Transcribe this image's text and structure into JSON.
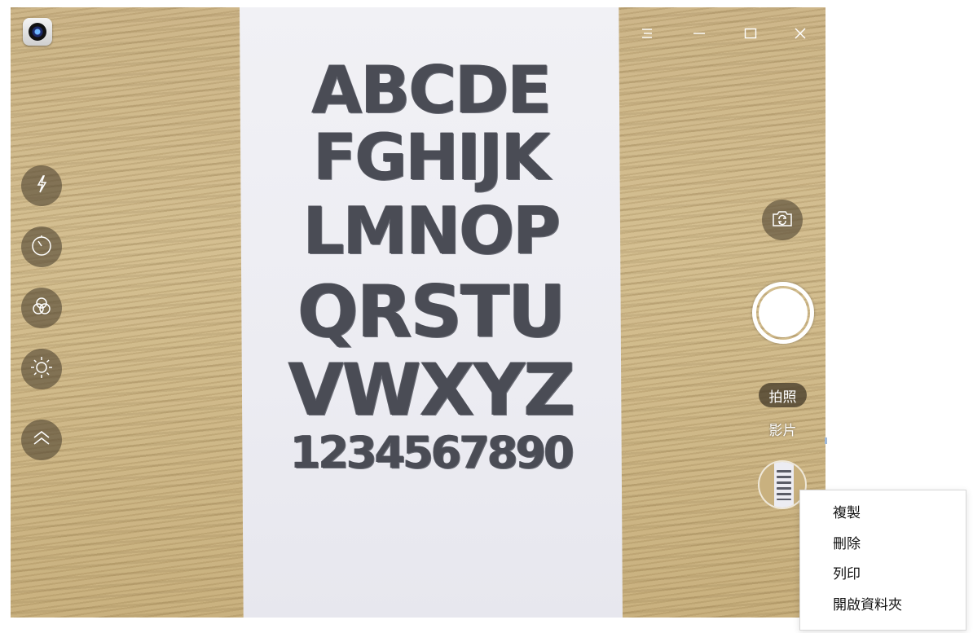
{
  "viewfinder": {
    "paper_rows": [
      "ABCDE",
      "FGHIJK",
      "LMNOP",
      "QRSTU",
      "VWXYZ",
      "1234567890"
    ]
  },
  "window": {
    "app_icon": "camera-app-icon",
    "controls": [
      "menu-icon",
      "minimize-icon",
      "maximize-icon",
      "close-icon"
    ]
  },
  "left_controls": [
    "flash-icon",
    "timer-icon",
    "filter-icon",
    "brightness-icon",
    "expand-up-icon"
  ],
  "right_controls": {
    "switch_camera_icon": "switch-camera-icon",
    "mode_photo": "拍照",
    "mode_video": "影片"
  },
  "context_menu": {
    "items": [
      "複製",
      "刪除",
      "列印",
      "開啟資料夾"
    ]
  },
  "colors": {
    "control_bg": "#50463280",
    "menu_bg": "#ffffff"
  }
}
